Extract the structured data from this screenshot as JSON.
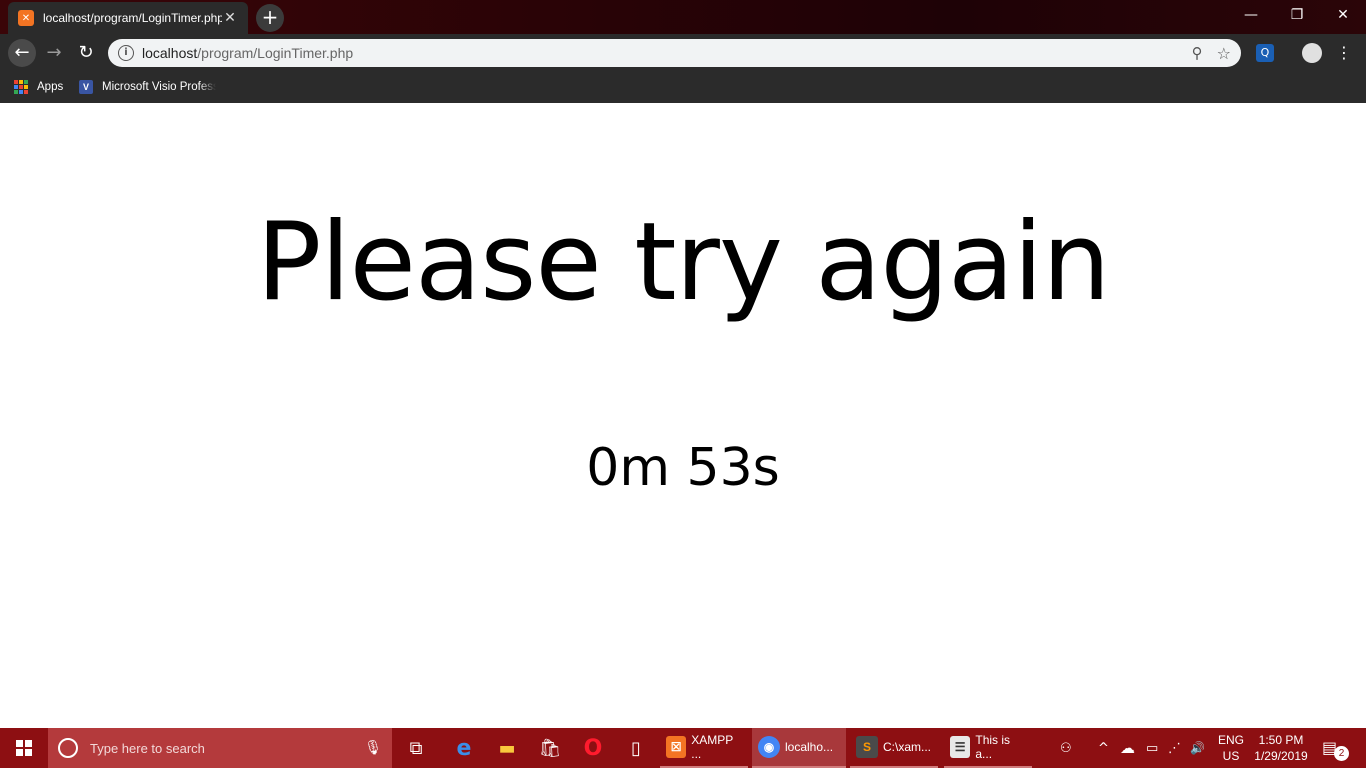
{
  "browser": {
    "tab": {
      "title": "localhost/program/LoginTimer.php",
      "favicon": "xampp-icon",
      "close": "✕"
    },
    "new_tab": "+",
    "window_controls": {
      "minimize": "—",
      "maximize": "❐",
      "close": "✕"
    },
    "nav": {
      "back": "←",
      "forward": "→",
      "reload": "↻"
    },
    "address": {
      "host": "localhost",
      "path": "/program/LoginTimer.php",
      "info_icon": "i"
    },
    "omnibox_icons": {
      "zoom": "⚲",
      "star": "☆"
    },
    "extension_icon": "Q",
    "menu": "⋮",
    "bookmarks": [
      {
        "label": "Apps",
        "icon": "apps-grid-icon"
      },
      {
        "label": "Microsoft Visio Professional",
        "icon": "visio-icon"
      }
    ]
  },
  "page": {
    "headline": "Please try again",
    "timer": "0m 53s"
  },
  "taskbar": {
    "search_placeholder": "Type here to search",
    "mic": "🎙",
    "pinned": [
      {
        "name": "task-view-icon",
        "glyph": "⧉"
      },
      {
        "name": "edge-icon",
        "glyph": "e"
      },
      {
        "name": "file-explorer-icon",
        "glyph": "▬"
      },
      {
        "name": "store-icon",
        "glyph": "🛍"
      },
      {
        "name": "opera-icon",
        "glyph": "O"
      },
      {
        "name": "file-icon",
        "glyph": "▯"
      }
    ],
    "apps": [
      {
        "label": "XAMPP ...",
        "icon": "xampp-icon",
        "color": "#f37423",
        "glyph": "☒"
      },
      {
        "label": "localho...",
        "icon": "chrome-icon",
        "color": "#4285f4",
        "glyph": "◉"
      },
      {
        "label": "C:\\xam...",
        "icon": "sublime-icon",
        "color": "#4a4a4a",
        "glyph": "S"
      },
      {
        "label": "This is a...",
        "icon": "notepad-icon",
        "color": "#e8e8e8",
        "glyph": "☰"
      }
    ],
    "tray": {
      "people": "⚇",
      "chevron": "^",
      "onedrive": "☁",
      "battery": "▭",
      "network": "⋰",
      "volume": "🔊"
    },
    "language": {
      "line1": "ENG",
      "line2": "US"
    },
    "clock": {
      "time": "1:50 PM",
      "date": "1/29/2019"
    },
    "notifications": {
      "glyph": "▤",
      "count": "2"
    }
  },
  "colors": {
    "taskbar": "#8d0f12",
    "search_box": "#b43a3c",
    "browser_chrome": "#2b2b2b",
    "xampp_orange": "#f37423"
  }
}
